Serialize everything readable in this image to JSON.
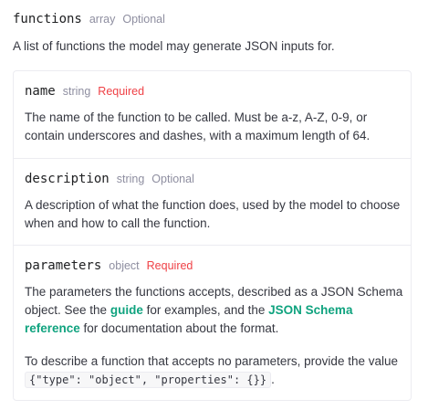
{
  "param": {
    "name": "functions",
    "type": "array",
    "qualifier": "Optional",
    "description": "A list of functions the model may generate JSON inputs for."
  },
  "children": {
    "name_field": {
      "name": "name",
      "type": "string",
      "qualifier": "Required",
      "description": "The name of the function to be called. Must be a-z, A-Z, 0-9, or contain underscores and dashes, with a maximum length of 64."
    },
    "description_field": {
      "name": "description",
      "type": "string",
      "qualifier": "Optional",
      "description": "A description of what the function does, used by the model to choose when and how to call the function."
    },
    "parameters_field": {
      "name": "parameters",
      "type": "object",
      "qualifier": "Required",
      "text_before_guide": "The parameters the functions accepts, described as a JSON Schema object. See the ",
      "guide_link": "guide",
      "text_between_links": " for examples, and the ",
      "schema_link": "JSON Schema reference",
      "text_after_links": " for documentation about the format.",
      "text_empty_prefix": "To describe a function that accepts no parameters, provide the value ",
      "empty_code": "{\"type\": \"object\", \"properties\": {}}",
      "text_empty_suffix": "."
    }
  },
  "colors": {
    "required": "#ef4146",
    "optional": "#8e8ea0",
    "link": "#10a37f",
    "border": "#ececf1"
  }
}
